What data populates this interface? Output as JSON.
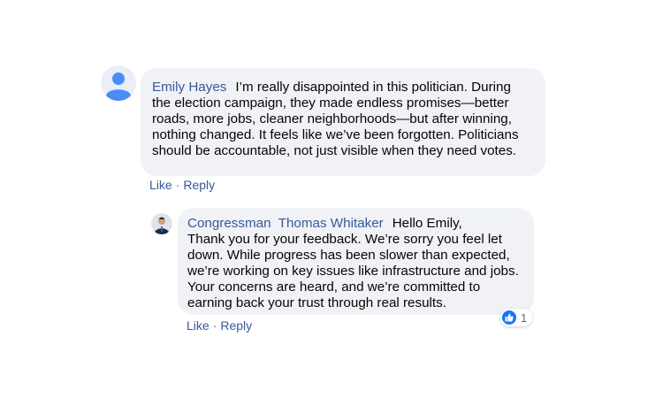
{
  "comment": {
    "author": "Emily Hayes",
    "text_lines": [
      "I’m really disappointed in this politician. During",
      "the election campaign, they made endless promises—better",
      "roads, more jobs, cleaner neighborhoods—but after winning,",
      "nothing changed. It feels like we’ve been forgotten. Politicians",
      "should be accountable, not just visible when they need votes."
    ],
    "like_label": "Like",
    "separator": "·",
    "reply_label": "Reply"
  },
  "reply": {
    "author": "Congressman  Thomas Whitaker",
    "greeting": "Hello Emily,",
    "text_lines": [
      "Thank you for your feedback. We’re sorry you feel let",
      "down. While progress has been slower than expected,",
      "we’re working on key issues like infrastructure and jobs.",
      "Your concerns are heard, and we’re committed to",
      "earning back your trust through real results."
    ],
    "like_label": "Like",
    "separator": "·",
    "reply_label": "Reply",
    "reaction_count": "1",
    "reaction_icon": "thumbs-up-icon"
  },
  "colors": {
    "name": "#385898",
    "bubble": "#f0f2f5",
    "like_blue": "#1877f2",
    "default_avatar": "#4a8df6"
  }
}
